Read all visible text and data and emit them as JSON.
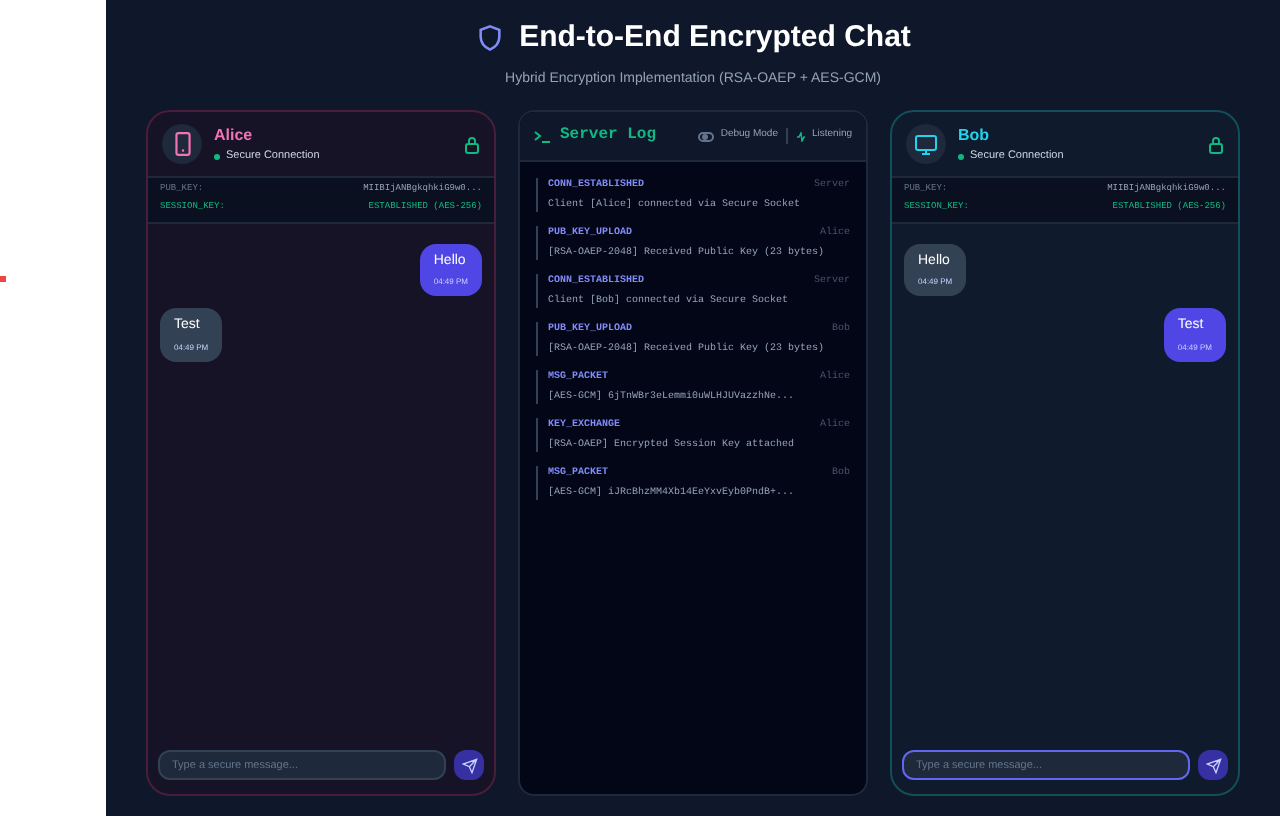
{
  "header": {
    "title": "End-to-End Encrypted Chat",
    "subtitle": "Hybrid Encryption Implementation (RSA-OAEP + AES-GCM)"
  },
  "users": [
    {
      "name": "Alice",
      "kind": "phone",
      "status": "Secure Connection",
      "pub_key_label": "PUB_KEY:",
      "pub_key": "MIIBIjANBgkqhkiG9w0...",
      "session_label": "SESSION_KEY:",
      "session": "ESTABLISHED (AES-256)",
      "placeholder": "Type a secure message...",
      "focused": false,
      "messages": [
        {
          "text": "Hello",
          "time": "04:49 PM",
          "outgoing": true
        },
        {
          "text": "Test",
          "time": "04:49 PM",
          "outgoing": false
        }
      ]
    },
    {
      "name": "Bob",
      "kind": "desktop",
      "status": "Secure Connection",
      "pub_key_label": "PUB_KEY:",
      "pub_key": "MIIBIjANBgkqhkiG9w0...",
      "session_label": "SESSION_KEY:",
      "session": "ESTABLISHED (AES-256)",
      "placeholder": "Type a secure message...",
      "focused": true,
      "messages": [
        {
          "text": "Hello",
          "time": "04:49 PM",
          "outgoing": false
        },
        {
          "text": "Test",
          "time": "04:49 PM",
          "outgoing": true
        }
      ]
    }
  ],
  "server_log": {
    "title": "Server Log",
    "debug_label": "Debug Mode",
    "debug_on": false,
    "status": "Listening",
    "entries": [
      {
        "event": "CONN_ESTABLISHED",
        "source": "Server",
        "text": "Client [Alice] connected via Secure Socket"
      },
      {
        "event": "PUB_KEY_UPLOAD",
        "source": "Alice",
        "text": "[RSA-OAEP-2048] Received Public Key (23 bytes)"
      },
      {
        "event": "CONN_ESTABLISHED",
        "source": "Server",
        "text": "Client [Bob] connected via Secure Socket"
      },
      {
        "event": "PUB_KEY_UPLOAD",
        "source": "Bob",
        "text": "[RSA-OAEP-2048] Received Public Key (23 bytes)"
      },
      {
        "event": "MSG_PACKET",
        "source": "Alice",
        "text": "[AES-GCM] 6jTnWBr3eLemmi0uWLHJUVazzhNe..."
      },
      {
        "event": "KEY_EXCHANGE",
        "source": "Alice",
        "text": "[RSA-OAEP] Encrypted Session Key attached"
      },
      {
        "event": "MSG_PACKET",
        "source": "Bob",
        "text": "[AES-GCM] iJRcBhzMM4Xb14EeYxvEyb0PndB+..."
      }
    ]
  }
}
